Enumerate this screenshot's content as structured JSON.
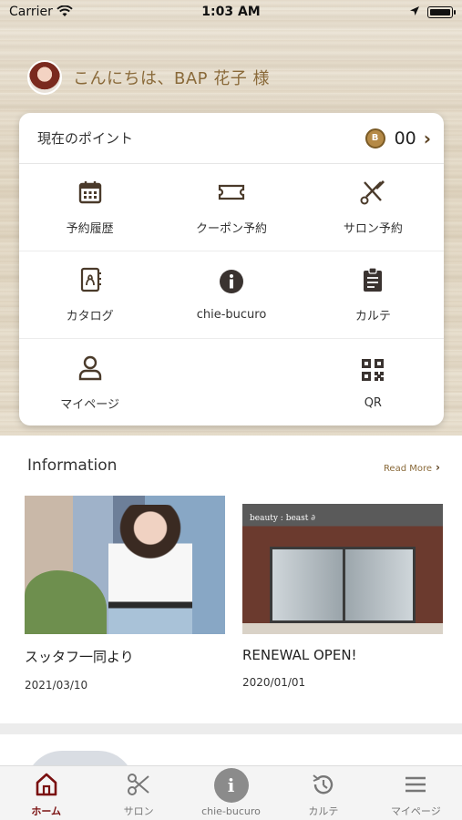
{
  "status_bar": {
    "carrier": "Carrier",
    "time": "1:03 AM"
  },
  "greeting": {
    "text": "こんにちは、BAP 花子 様"
  },
  "points_card": {
    "title": "現在のポイント",
    "coin_letter": "B",
    "points": "00",
    "menu_rows": [
      [
        {
          "label": "予約履歴",
          "icon": "calendar-icon"
        },
        {
          "label": "クーポン予約",
          "icon": "ticket-icon"
        },
        {
          "label": "サロン予約",
          "icon": "scissors-comb-icon"
        }
      ],
      [
        {
          "label": "カタログ",
          "icon": "catalog-book-icon"
        },
        {
          "label": "chie-bucuro",
          "icon": "info-icon"
        },
        {
          "label": "カルテ",
          "icon": "clipboard-icon"
        }
      ],
      [
        {
          "label": "マイページ",
          "icon": "user-icon"
        },
        {
          "label": "",
          "icon": ""
        },
        {
          "label": "QR",
          "icon": "qr-code-icon"
        }
      ]
    ]
  },
  "information": {
    "title": "Information",
    "read_more": "Read More",
    "items": [
      {
        "headline": "スッタフ一同より",
        "date": "2021/03/10"
      },
      {
        "headline": "RENEWAL OPEN!",
        "date": "2020/01/01",
        "sign_text": "beauty : beast ∂"
      }
    ]
  },
  "tab_bar": {
    "tabs": [
      {
        "label": "ホーム",
        "icon": "home-icon",
        "active": true
      },
      {
        "label": "サロン",
        "icon": "scissors-icon",
        "active": false
      },
      {
        "label": "chie-bucuro",
        "icon": "info-icon",
        "active": false
      },
      {
        "label": "カルテ",
        "icon": "history-icon",
        "active": false
      },
      {
        "label": "マイページ",
        "icon": "menu-icon",
        "active": false
      }
    ]
  },
  "colors": {
    "accent_brown": "#8a6a3a",
    "icon_dark": "#4a3a2a",
    "active_tab": "#7a1010"
  }
}
